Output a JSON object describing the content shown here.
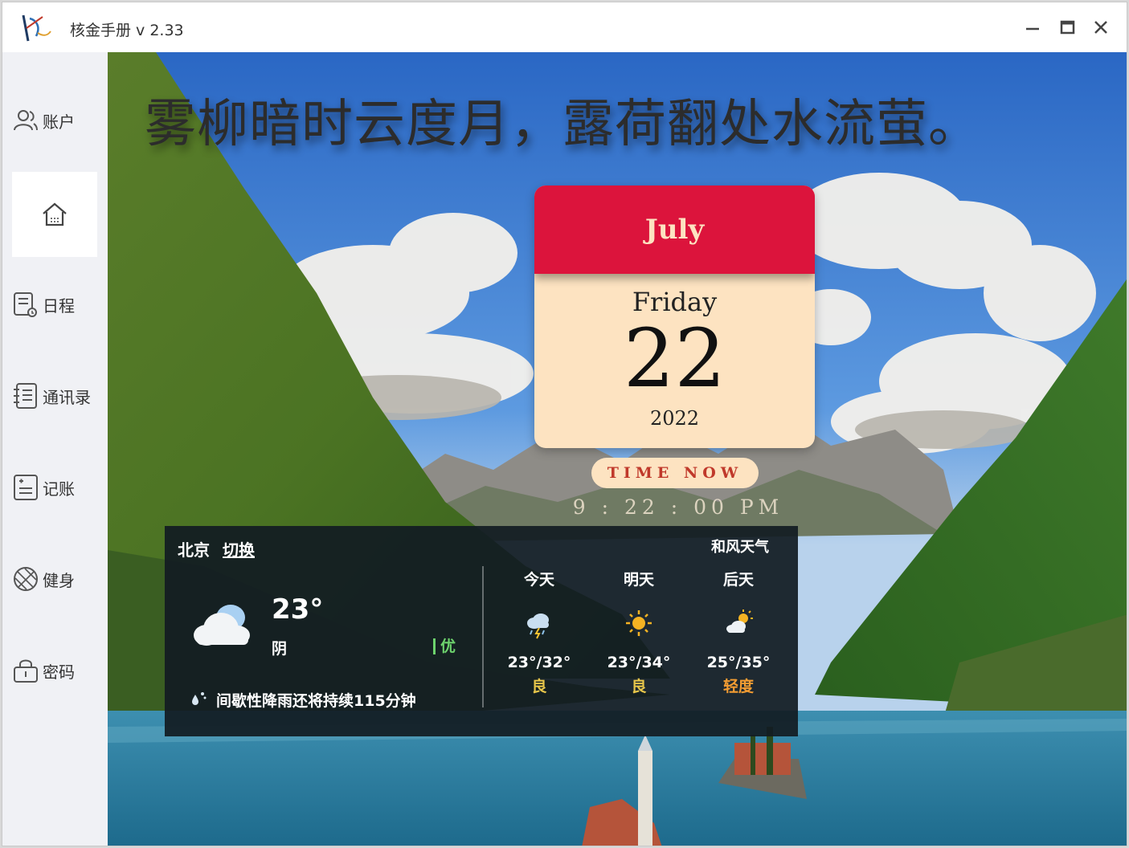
{
  "window": {
    "title": "核金手册 v 2.33"
  },
  "sidebar": {
    "items": [
      {
        "label": "账户",
        "icon": "user-icon"
      },
      {
        "label": "",
        "icon": "home-icon",
        "active": true
      },
      {
        "label": "日程",
        "icon": "schedule-icon"
      },
      {
        "label": "通讯录",
        "icon": "contacts-icon"
      },
      {
        "label": "记账",
        "icon": "ledger-icon"
      },
      {
        "label": "健身",
        "icon": "fitness-icon"
      },
      {
        "label": "密码",
        "icon": "password-icon"
      }
    ]
  },
  "poem": "雾柳暗时云度月，露荷翻处水流萤。",
  "calendar": {
    "month": "July",
    "weekday": "Friday",
    "day": "22",
    "year": "2022",
    "accent": "#dc143c"
  },
  "clock": {
    "label": "TIME NOW",
    "time": "9 : 22 : 00 PM"
  },
  "weather": {
    "city": "北京",
    "switch_label": "切换",
    "brand": "和风天气",
    "current": {
      "temp": "23°",
      "condition": "阴",
      "aqi": "优",
      "icon": "cloudy-icon"
    },
    "precip_note": "间歇性降雨还将持续115分钟",
    "forecast": [
      {
        "day": "今天",
        "icon": "thunder-rain-icon",
        "range": "23°/32°",
        "quality": "良",
        "quality_color": "#e8c64a"
      },
      {
        "day": "明天",
        "icon": "sunny-icon",
        "range": "23°/34°",
        "quality": "良",
        "quality_color": "#e8c64a"
      },
      {
        "day": "后天",
        "icon": "partly-cloudy-icon",
        "range": "25°/35°",
        "quality": "轻度",
        "quality_color": "#f39c32"
      }
    ]
  }
}
